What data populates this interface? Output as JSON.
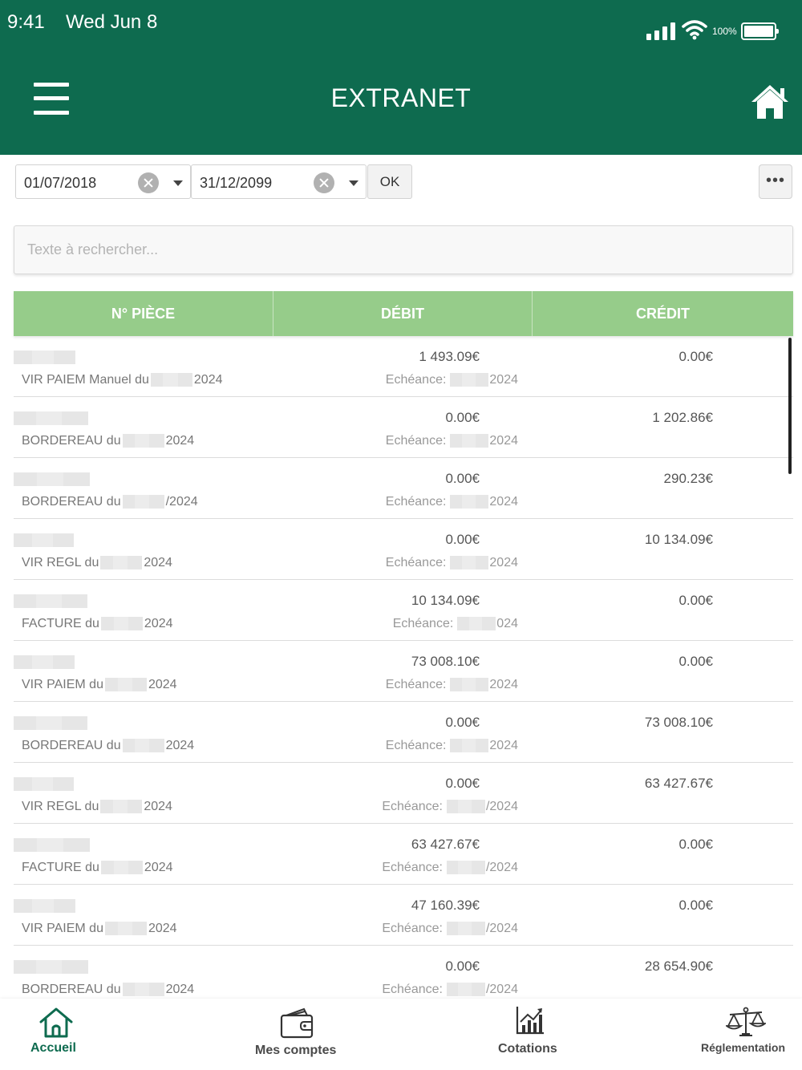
{
  "status_bar": {
    "time": "9:41",
    "date": "Wed Jun 8",
    "battery": "100%"
  },
  "header": {
    "title": "EXTRANET"
  },
  "filters": {
    "date_from": "01/07/2018",
    "date_to": "31/12/2099",
    "ok_label": "OK",
    "more_label": "•••"
  },
  "search": {
    "placeholder": "Texte à rechercher..."
  },
  "table": {
    "columns": [
      "N° PIÈCE",
      "DÉBIT",
      "CRÉDIT"
    ],
    "echeance_prefix": "Echéance:",
    "rows": [
      {
        "libelle": "VIR PAIEM Manuel du",
        "libelle_suffix": "2024",
        "debit": "1 493.09€",
        "credit": "0.00€",
        "ech_suffix": "2024"
      },
      {
        "libelle": "BORDEREAU du",
        "libelle_suffix": "2024",
        "debit": "0.00€",
        "credit": "1 202.86€",
        "ech_suffix": "2024"
      },
      {
        "libelle": "BORDEREAU du",
        "libelle_suffix": "/2024",
        "debit": "0.00€",
        "credit": "290.23€",
        "ech_suffix": "2024"
      },
      {
        "libelle": "VIR REGL du",
        "libelle_suffix": "2024",
        "debit": "0.00€",
        "credit": "10 134.09€",
        "ech_suffix": "2024"
      },
      {
        "libelle": "FACTURE du",
        "libelle_suffix": "2024",
        "debit": "10 134.09€",
        "credit": "0.00€",
        "ech_suffix": "024"
      },
      {
        "libelle": "VIR PAIEM du",
        "libelle_suffix": "2024",
        "debit": "73 008.10€",
        "credit": "0.00€",
        "ech_suffix": "2024"
      },
      {
        "libelle": "BORDEREAU du",
        "libelle_suffix": "2024",
        "debit": "0.00€",
        "credit": "73 008.10€",
        "ech_suffix": "2024"
      },
      {
        "libelle": "VIR REGL du",
        "libelle_suffix": "2024",
        "debit": "0.00€",
        "credit": "63 427.67€",
        "ech_suffix": "/2024"
      },
      {
        "libelle": "FACTURE du",
        "libelle_suffix": "2024",
        "debit": "63 427.67€",
        "credit": "0.00€",
        "ech_suffix": "/2024"
      },
      {
        "libelle": "VIR PAIEM du",
        "libelle_suffix": "2024",
        "debit": "47 160.39€",
        "credit": "0.00€",
        "ech_suffix": "/2024"
      },
      {
        "libelle": "BORDEREAU du",
        "libelle_suffix": "2024",
        "debit": "0.00€",
        "credit": "28 654.90€",
        "ech_suffix": "/2024"
      }
    ]
  },
  "bottom_nav": [
    {
      "label": "Accueil",
      "icon": "home-icon",
      "active": true
    },
    {
      "label": "Mes comptes",
      "icon": "wallet-icon",
      "active": false
    },
    {
      "label": "Cotations",
      "icon": "chart-icon",
      "active": false
    },
    {
      "label": "Réglementation",
      "icon": "scales-icon",
      "active": false
    }
  ],
  "colors": {
    "header": "#0e6b4f",
    "table_header": "#96cc8a",
    "active_nav": "#0e6b4f"
  }
}
